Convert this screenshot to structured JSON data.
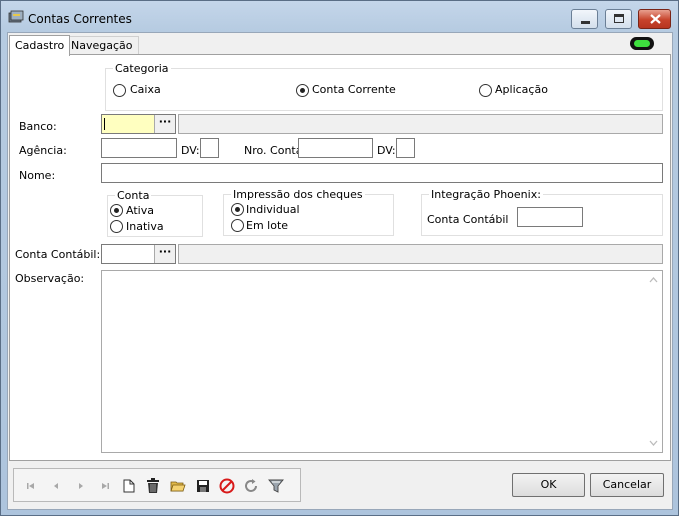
{
  "window": {
    "title": "Contas Correntes"
  },
  "tabs": [
    {
      "label": "Cadastro"
    },
    {
      "label": "Navegação"
    }
  ],
  "categoria": {
    "label": "Categoria",
    "options": [
      {
        "label": "Caixa",
        "checked": false
      },
      {
        "label": "Conta Corrente",
        "checked": true
      },
      {
        "label": "Aplicação",
        "checked": false
      }
    ]
  },
  "form": {
    "banco_label": "Banco:",
    "banco_value": "",
    "agencia_label": "Agência:",
    "dv_label": "DV:",
    "nro_conta_label": "Nro. Conta",
    "nome_label": "Nome:",
    "conta_contabil_label": "Conta Contábil:",
    "observacao_label": "Observação:",
    "ellipsis": "···"
  },
  "conta": {
    "label": "Conta",
    "options": [
      {
        "label": "Ativa",
        "checked": true
      },
      {
        "label": "Inativa",
        "checked": false
      }
    ]
  },
  "impressao": {
    "label": "Impressão dos cheques",
    "options": [
      {
        "label": "Individual",
        "checked": true
      },
      {
        "label": "Em lote",
        "checked": false
      }
    ]
  },
  "integracao": {
    "label": "Integração Phoenix:",
    "conta_contabil_label": "Conta Contábil"
  },
  "buttons": {
    "ok": "OK",
    "cancel": "Cancelar"
  },
  "icons": [
    "first-record-icon",
    "prior-record-icon",
    "next-record-icon",
    "last-record-icon",
    "new-document-icon",
    "delete-trash-icon",
    "open-folder-icon",
    "save-disk-icon",
    "cancel-stop-icon",
    "refresh-icon",
    "filter-funnel-icon"
  ],
  "colors": {
    "required_field": "#ffffc0",
    "led_green": "#3ee03e",
    "close_button": "#c7432b"
  }
}
